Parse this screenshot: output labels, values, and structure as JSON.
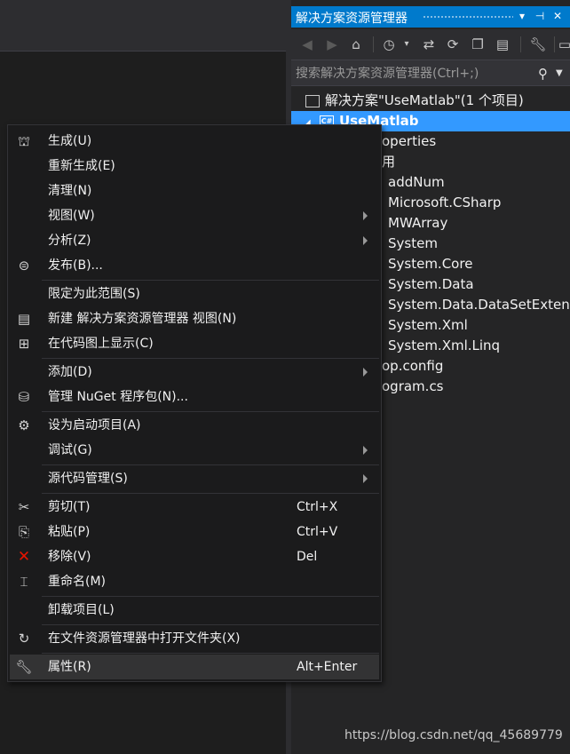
{
  "solution_explorer": {
    "title": "解决方案资源管理器",
    "title_buttons": [
      "▾",
      "⊣",
      "✕"
    ],
    "search_placeholder": "搜索解决方案资源管理器(Ctrl+;)",
    "tree": [
      {
        "label": "解决方案\"UseMatlab\"(1 个项目)",
        "icon": "solution-icon"
      },
      {
        "label": "UseMatlab",
        "icon": "csharp-project-icon",
        "selected": true
      },
      {
        "label": "operties"
      },
      {
        "label": "用"
      },
      {
        "label": "addNum"
      },
      {
        "label": "Microsoft.CSharp"
      },
      {
        "label": "MWArray"
      },
      {
        "label": "System"
      },
      {
        "label": "System.Core"
      },
      {
        "label": "System.Data"
      },
      {
        "label": "System.Data.DataSetExtensio"
      },
      {
        "label": "System.Xml"
      },
      {
        "label": "System.Xml.Linq"
      },
      {
        "label": "op.config"
      },
      {
        "label": "ogram.cs"
      }
    ]
  },
  "context_menu": {
    "items": [
      {
        "label": "生成(U)",
        "icon": "build-icon"
      },
      {
        "label": "重新生成(E)"
      },
      {
        "label": "清理(N)"
      },
      {
        "label": "视图(W)",
        "submenu": true
      },
      {
        "label": "分析(Z)",
        "submenu": true
      },
      {
        "label": "发布(B)...",
        "icon": "publish-icon"
      },
      {
        "label": "限定为此范围(S)"
      },
      {
        "label": "新建 解决方案资源管理器 视图(N)",
        "icon": "new-view-icon"
      },
      {
        "label": "在代码图上显示(C)",
        "icon": "code-map-icon"
      },
      {
        "label": "添加(D)",
        "submenu": true
      },
      {
        "label": "管理 NuGet 程序包(N)...",
        "icon": "nuget-icon"
      },
      {
        "label": "设为启动项目(A)",
        "icon": "gear-icon"
      },
      {
        "label": "调试(G)",
        "submenu": true
      },
      {
        "label": "源代码管理(S)",
        "submenu": true
      },
      {
        "label": "剪切(T)",
        "icon": "cut-icon",
        "shortcut": "Ctrl+X"
      },
      {
        "label": "粘贴(P)",
        "icon": "paste-icon",
        "shortcut": "Ctrl+V"
      },
      {
        "label": "移除(V)",
        "icon": "remove-icon",
        "shortcut": "Del"
      },
      {
        "label": "重命名(M)",
        "icon": "rename-icon"
      },
      {
        "label": "卸载项目(L)"
      },
      {
        "label": "在文件资源管理器中打开文件夹(X)",
        "icon": "open-folder-icon"
      },
      {
        "label": "属性(R)",
        "icon": "wrench-icon",
        "shortcut": "Alt+Enter",
        "hover": true
      }
    ]
  },
  "colors": {
    "accent": "#007acc",
    "selection": "#3399ff",
    "menu_bg": "#1b1b1c",
    "remove_icon": "#e51400"
  },
  "watermark": "https://blog.csdn.net/qq_45689779"
}
